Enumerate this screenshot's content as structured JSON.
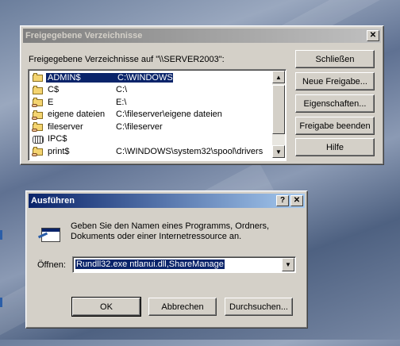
{
  "shares_dialog": {
    "title": "Freigegebene Verzeichnisse",
    "close": "✕",
    "heading": "Freigegebene Verzeichnisse auf \"\\\\SERVER2003\":",
    "shares": [
      {
        "name": "ADMIN$",
        "path": "C:\\WINDOWS",
        "icon": "folder-icon",
        "selected": true
      },
      {
        "name": "C$",
        "path": "C:\\",
        "icon": "folder-icon",
        "selected": false
      },
      {
        "name": "E",
        "path": "E:\\",
        "icon": "shared-folder-icon",
        "selected": false
      },
      {
        "name": "eigene dateien",
        "path": "C:\\fileserver\\eigene dateien",
        "icon": "shared-folder-icon",
        "selected": false
      },
      {
        "name": "fileserver",
        "path": "C:\\fileserver",
        "icon": "shared-folder-icon",
        "selected": false
      },
      {
        "name": "IPC$",
        "path": "",
        "icon": "pipe-icon",
        "selected": false
      },
      {
        "name": "print$",
        "path": "C:\\WINDOWS\\system32\\spool\\drivers",
        "icon": "shared-folder-icon",
        "selected": false
      }
    ],
    "buttons": {
      "close": "Schließen",
      "new_share": "Neue Freigabe...",
      "properties": "Eigenschaften...",
      "stop_sharing": "Freigabe beenden",
      "help": "Hilfe"
    }
  },
  "run_dialog": {
    "title": "Ausführen",
    "help": "?",
    "close": "✕",
    "description": "Geben Sie den Namen eines Programms, Ordners, Dokuments oder einer Internetressource an.",
    "open_label": "Öffnen:",
    "command": "Rundll32.exe ntlanui.dll,ShareManage",
    "buttons": {
      "ok": "OK",
      "cancel": "Abbrechen",
      "browse": "Durchsuchen..."
    }
  },
  "colors": {
    "selection": "#0a246a",
    "face": "#d4d0c8",
    "active_title": "#0a246a",
    "inactive_title": "#808080"
  }
}
